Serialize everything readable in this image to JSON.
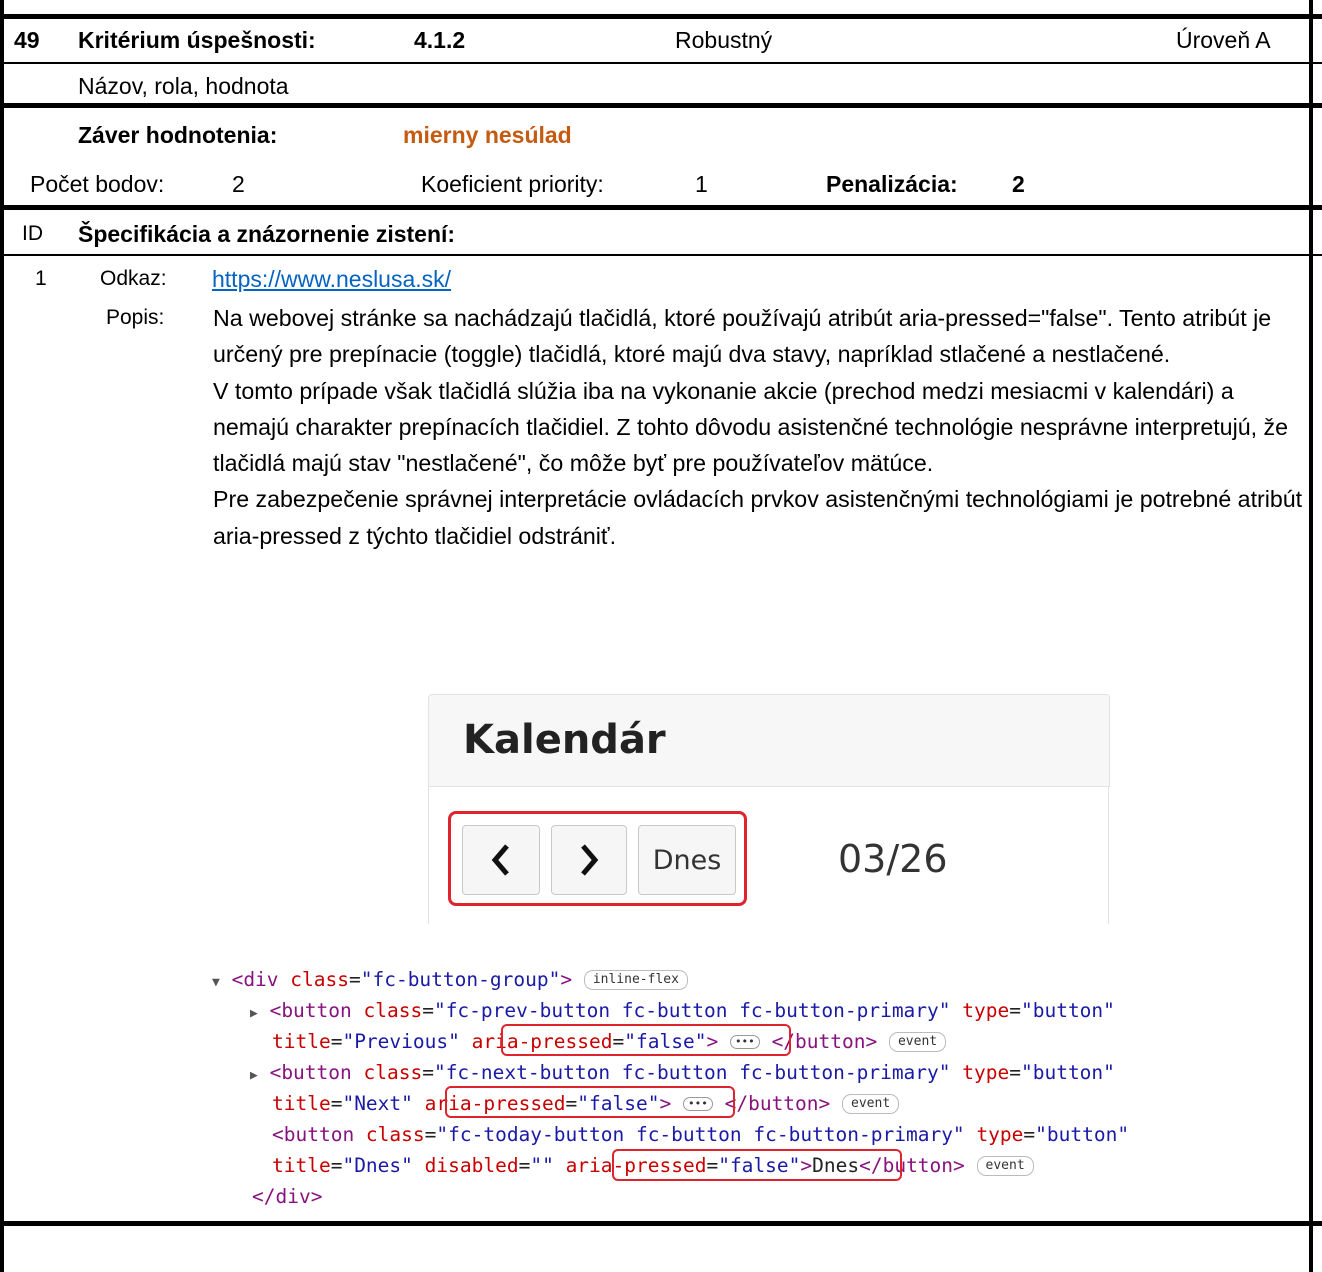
{
  "header": {
    "number": "49",
    "criterion_label": "Kritérium úspešnosti:",
    "criterion_code": "4.1.2",
    "principle": "Robustný",
    "level": "Úroveň A",
    "criterion_name": "Názov, rola, hodnota"
  },
  "evaluation": {
    "conclusion_label": "Záver hodnotenia:",
    "conclusion_value": "mierny nesúlad",
    "points_label": "Počet bodov:",
    "points_value": "2",
    "priority_label": "Koeficient priority:",
    "priority_value": "1",
    "penalty_label": "Penalizácia:",
    "penalty_value": "2"
  },
  "findings": {
    "id_label": "ID",
    "heading": "Špecifikácia a znázornenie zistení:",
    "items": [
      {
        "id": "1",
        "link_label": "Odkaz:",
        "link_url": "https://www.neslusa.sk/",
        "desc_label": "Popis:",
        "desc_paragraphs": [
          "Na webovej stránke sa nachádzajú tlačidlá, ktoré používajú atribút aria-pressed=\"false\". Tento atribút je určený pre prepínacie (toggle) tlačidlá, ktoré majú dva stavy, napríklad stlačené a nestlačené.",
          "V tomto prípade však tlačidlá slúžia iba na vykonanie akcie (prechod medzi mesiacmi v kalendári) a nemajú charakter prepínacích tlačidiel. Z tohto dôvodu asistenčné technológie nesprávne interpretujú, že tlačidlá majú stav \"nestlačené\", čo môže byť pre používateľov mätúce.",
          "Pre zabezpečenie správnej interpretácie ovládacích prvkov asistenčnými technológiami je potrebné atribút aria-pressed z týchto tlačidiel odstrániť."
        ]
      }
    ]
  },
  "screenshot": {
    "calendar_title": "Kalendár",
    "today_button": "Dnes",
    "date": "03/26",
    "prev_icon": "chevron-left-icon",
    "next_icon": "chevron-right-icon"
  },
  "code": {
    "div_open": "<div class=\"fc-button-group\">",
    "div_badge": "inline-flex",
    "event_badge": "event",
    "div_close": "</div>"
  },
  "colors": {
    "conclusion": "#c55a11",
    "link": "#0563c1",
    "highlight": "#e0242e"
  }
}
